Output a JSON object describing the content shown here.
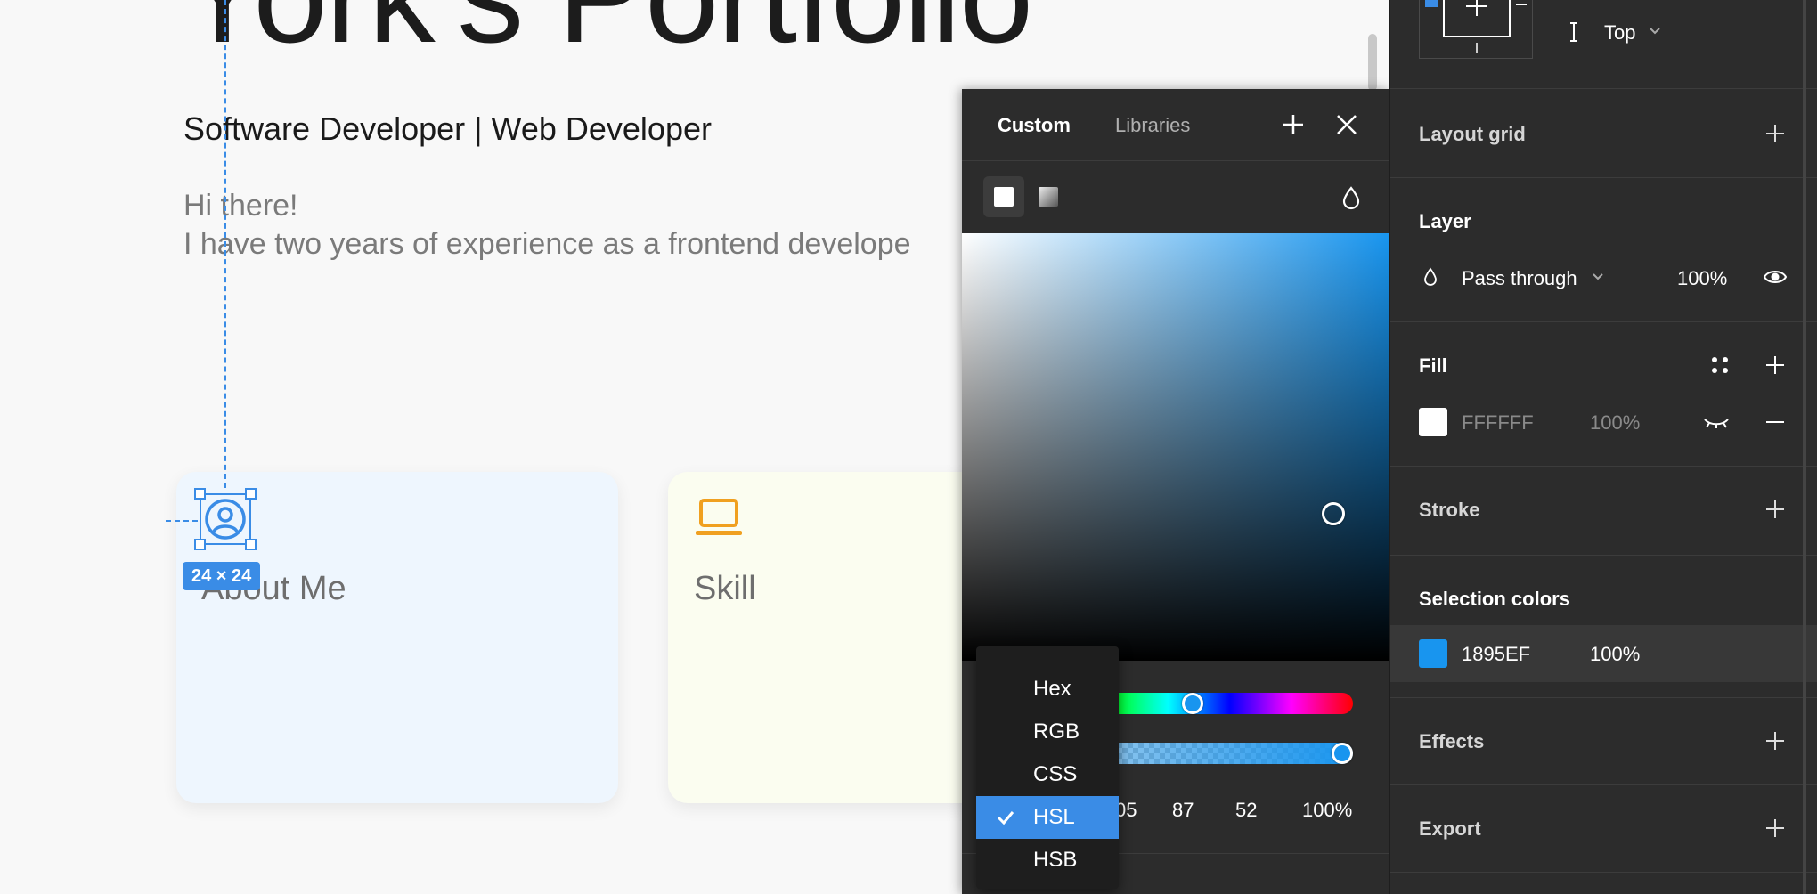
{
  "canvas": {
    "hero_title": "York's Portfolio",
    "subtitle": "Software Developer | Web Developer",
    "intro_line1": "Hi there!",
    "intro_line2": "I have two years of experience as a frontend develope",
    "selection_size": "24 × 24",
    "cards": [
      {
        "label": "About Me",
        "icon": "user-circle-icon"
      },
      {
        "label": "Skill",
        "icon": "laptop-icon"
      }
    ]
  },
  "color_picker": {
    "tabs": [
      "Custom",
      "Libraries"
    ],
    "active_tab": "Custom",
    "fill_types": [
      "solid-fill-icon",
      "gradient-fill-icon"
    ],
    "hue": 205,
    "alpha": 1.0,
    "values": {
      "h": "05",
      "s": "87",
      "l": "52",
      "a": "100%"
    },
    "format_dropdown": {
      "options": [
        "Hex",
        "RGB",
        "CSS",
        "HSL",
        "HSB"
      ],
      "selected": "HSL"
    }
  },
  "properties_panel": {
    "constraints": {
      "vertical": "Top"
    },
    "layout_grid": {
      "title": "Layout grid"
    },
    "layer": {
      "title": "Layer",
      "blend_mode": "Pass through",
      "opacity": "100%"
    },
    "fill": {
      "title": "Fill",
      "hex": "FFFFFF",
      "opacity": "100%",
      "swatch_color": "#FFFFFF"
    },
    "stroke": {
      "title": "Stroke"
    },
    "selection_colors": {
      "title": "Selection colors",
      "hex": "1895EF",
      "opacity": "100%",
      "swatch_color": "#1895EF"
    },
    "effects": {
      "title": "Effects"
    },
    "export": {
      "title": "Export"
    }
  },
  "colors": {
    "accent": "#3A8CE6",
    "selection": "#1895EF",
    "panel_bg": "#2C2C2C",
    "about_card_bg": "#EEF6FE",
    "skill_card_bg": "#FBFDF0",
    "skill_icon": "#F0A020"
  }
}
